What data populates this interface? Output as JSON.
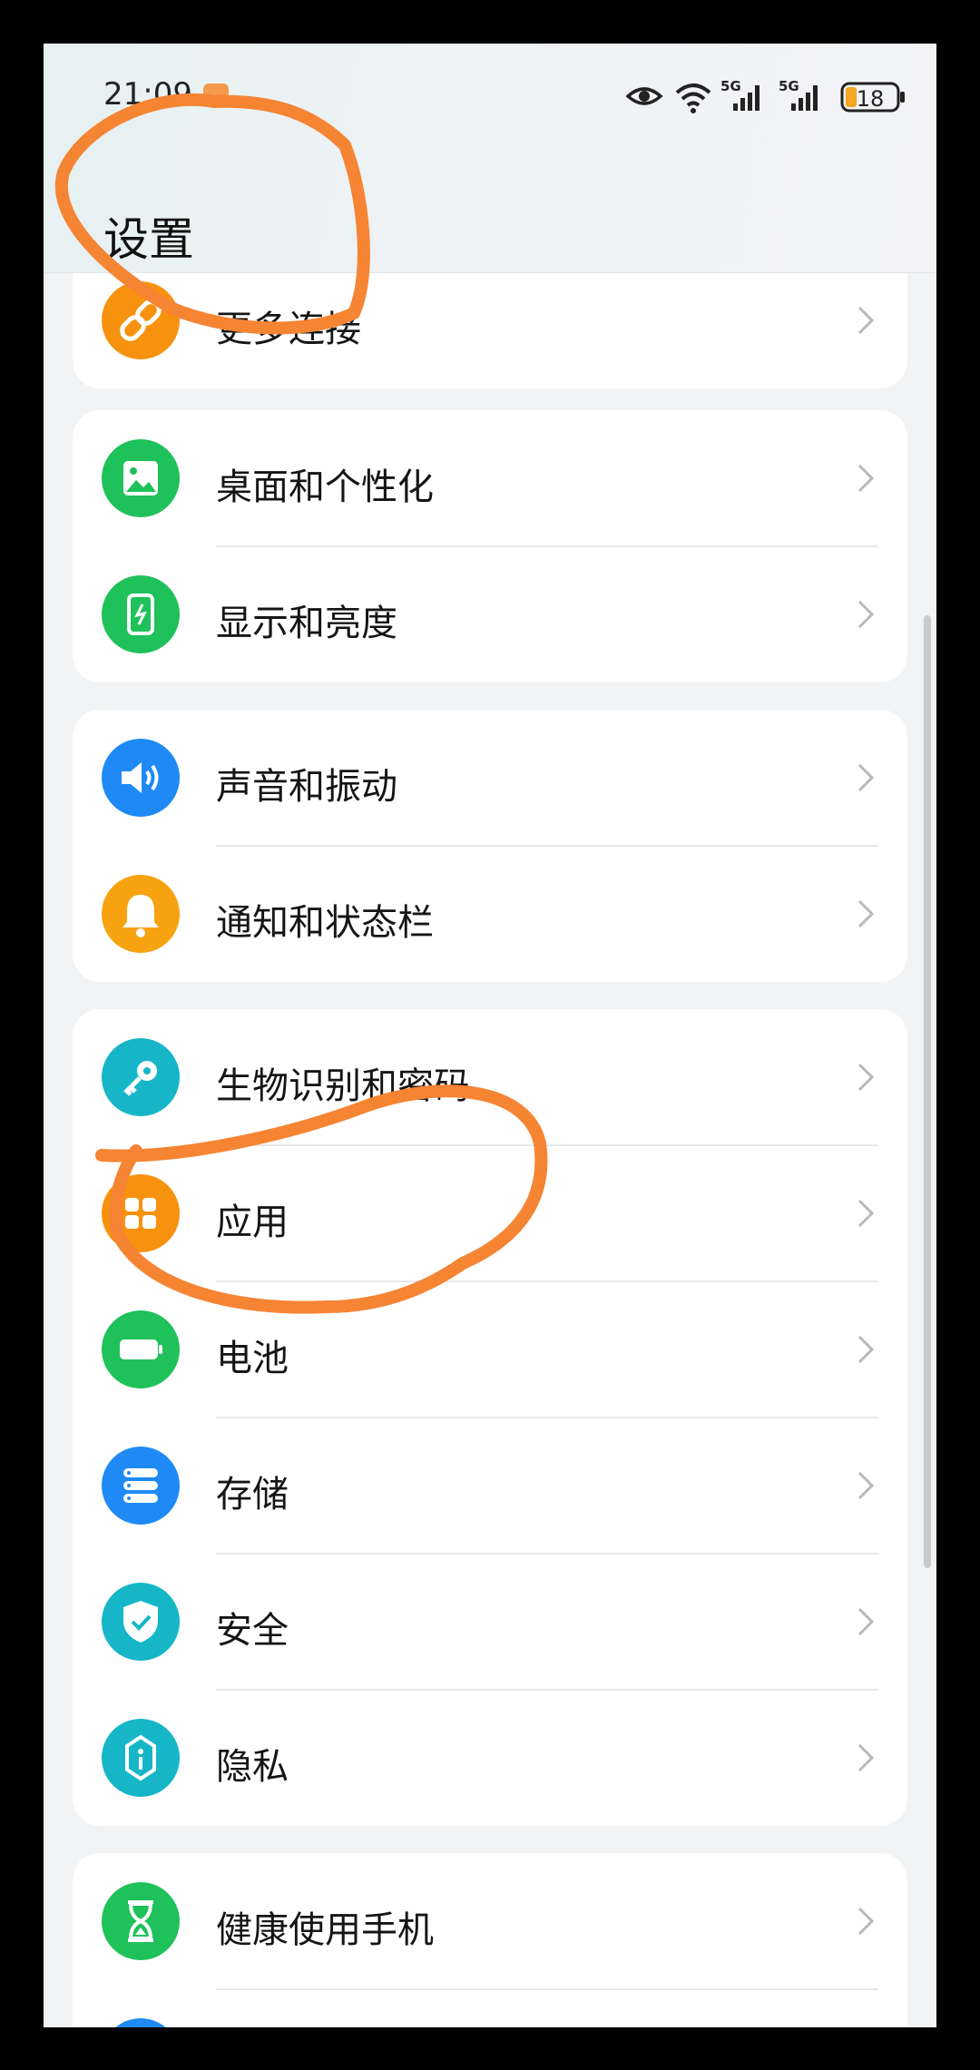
{
  "status_bar": {
    "time": "21:09",
    "icons": [
      "eye-icon",
      "wifi-icon",
      "signal-5g-icon",
      "signal-5g-icon",
      "battery-icon"
    ],
    "network_label_1": "5G",
    "network_label_2": "5G",
    "battery_level": "18"
  },
  "header": {
    "title": "设置"
  },
  "groups": [
    {
      "items": [
        {
          "label": "更多连接",
          "icon": "link-icon",
          "color": "#f7920f"
        }
      ]
    },
    {
      "items": [
        {
          "label": "桌面和个性化",
          "icon": "image-icon",
          "color": "#1fc15a"
        },
        {
          "label": "显示和亮度",
          "icon": "phone-brightness-icon",
          "color": "#1fc15a"
        }
      ]
    },
    {
      "items": [
        {
          "label": "声音和振动",
          "icon": "speaker-icon",
          "color": "#1f8af5"
        },
        {
          "label": "通知和状态栏",
          "icon": "bell-icon",
          "color": "#f7a20f"
        }
      ]
    },
    {
      "items": [
        {
          "label": "生物识别和密码",
          "icon": "key-icon",
          "color": "#16b6c8"
        },
        {
          "label": "应用",
          "icon": "apps-grid-icon",
          "color": "#f7920f"
        },
        {
          "label": "电池",
          "icon": "battery-icon",
          "color": "#1fc15a"
        },
        {
          "label": "存储",
          "icon": "storage-icon",
          "color": "#1f8af5"
        },
        {
          "label": "安全",
          "icon": "shield-icon",
          "color": "#16b6c8"
        },
        {
          "label": "隐私",
          "icon": "privacy-lock-icon",
          "color": "#16b6c8"
        }
      ]
    },
    {
      "items": [
        {
          "label": "健康使用手机",
          "icon": "hourglass-icon",
          "color": "#1fc15a"
        }
      ]
    }
  ],
  "colors": {
    "annotation": "#f58433",
    "background": "#f1f3f5",
    "card": "#ffffff"
  }
}
